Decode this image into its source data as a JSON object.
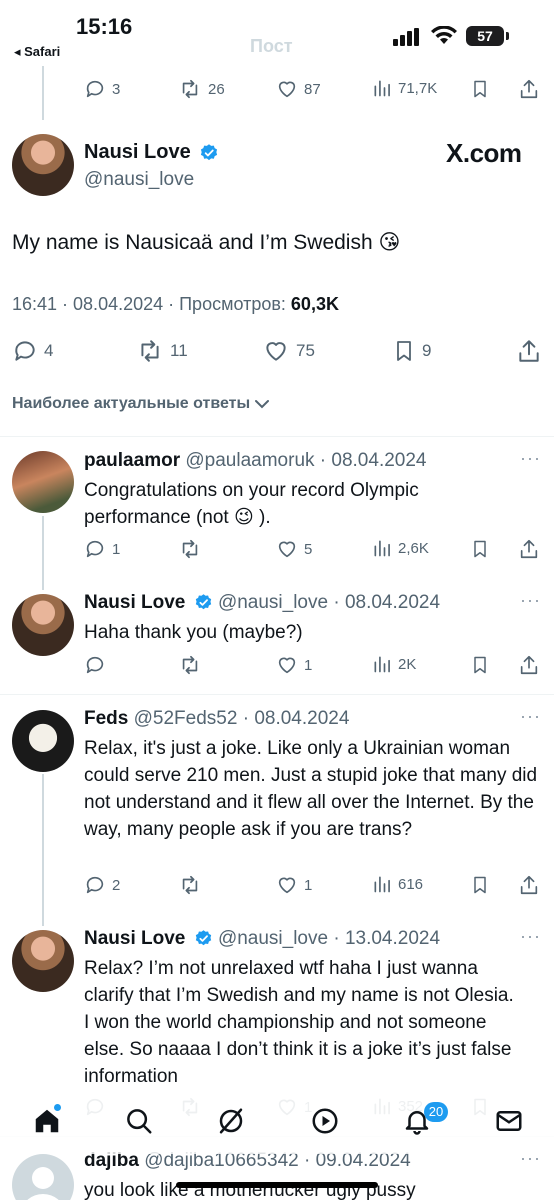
{
  "status_bar": {
    "time": "15:16",
    "back_app": "◂ Safari",
    "ghost_title": "Пост",
    "battery": "57"
  },
  "prev_actions": {
    "replies": "3",
    "reposts": "26",
    "likes": "87",
    "views": "71,7K"
  },
  "main_tweet": {
    "name": "Nausi Love",
    "handle": "@nausi_love",
    "watermark": "X.com",
    "text": "My name is Nausicaä and I’m Swedish 😘",
    "meta_prefix": "16:41 · 08.04.2024 · Просмотров:",
    "views": "60,3K",
    "replies": "4",
    "reposts": "11",
    "likes": "75",
    "bookmarks": "9"
  },
  "sort_label": "Наиболее актуальные ответы",
  "replies": [
    {
      "name": "paulaamor",
      "handle": "@paulaamoruk · 08.04.2024",
      "text": "Congratulations on your record Olympic performance (not 😉 ).",
      "replies": "1",
      "reposts": "",
      "likes": "5",
      "views": "2,6K"
    },
    {
      "name": "Nausi Love",
      "handle": "@nausi_love · 08.04.2024",
      "text": "Haha thank you (maybe?)",
      "replies": "",
      "reposts": "",
      "likes": "1",
      "views": "2K"
    },
    {
      "name": "Feds",
      "handle": "@52Feds52 · 08.04.2024",
      "text": "Relax, it's just a joke. Like only a Ukrainian woman could serve 210 men. Just a stupid joke that many did not understand and it flew all over the Internet. By the way, many people ask if you are trans?",
      "replies": "2",
      "reposts": "",
      "likes": "1",
      "views": "616"
    },
    {
      "name": "Nausi Love",
      "handle": "@nausi_love · 13.04.2024",
      "text": "Relax? I’m not unrelaxed wtf haha I just wanna clarify that I’m Swedish and my name is not Olesia. I won the world championship and not someone else. So naaaa I don’t think it is a joke it’s just false information",
      "replies": "",
      "reposts": "",
      "likes": "1",
      "views": "352"
    },
    {
      "name": "dajiba",
      "handle": "@dajiba10665342 · 09.04.2024",
      "text": "you look like a motherfucker ugly pussy"
    }
  ],
  "nav": {
    "notifications_badge": "20"
  },
  "colors": {
    "text": "#0f1419",
    "secondary": "#536471",
    "accent": "#1d9bf0",
    "divider": "#eff3f4"
  }
}
